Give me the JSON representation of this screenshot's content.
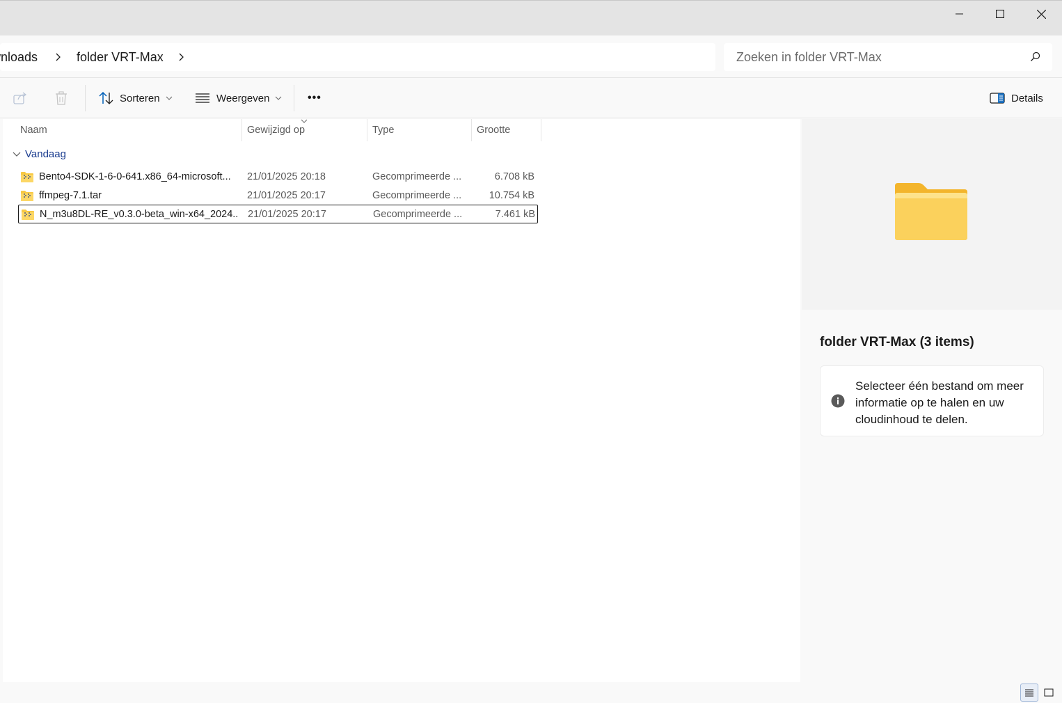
{
  "window": {
    "minimize": "minimize",
    "maximize": "maximize",
    "close": "close"
  },
  "address": {
    "crumbs": [
      "wnloads",
      "folder VRT-Max"
    ],
    "search_placeholder": "Zoeken in folder VRT-Max"
  },
  "toolbar": {
    "sort_label": "Sorteren",
    "view_label": "Weergeven",
    "more_label": "•••",
    "details_label": "Details"
  },
  "columns": {
    "name": "Naam",
    "modified": "Gewijzigd op",
    "type": "Type",
    "size": "Grootte"
  },
  "group": {
    "label": "Vandaag"
  },
  "files": [
    {
      "name": "Bento4-SDK-1-6-0-641.x86_64-microsoft...",
      "modified": "21/01/2025 20:18",
      "type": "Gecomprimeerde ...",
      "size": "6.708 kB"
    },
    {
      "name": "ffmpeg-7.1.tar",
      "modified": "21/01/2025 20:17",
      "type": "Gecomprimeerde ...",
      "size": "10.754 kB"
    },
    {
      "name": "N_m3u8DL-RE_v0.3.0-beta_win-x64_2024...",
      "modified": "21/01/2025 20:17",
      "type": "Gecomprimeerde ...",
      "size": "7.461 kB"
    }
  ],
  "details_pane": {
    "title": "folder VRT-Max (3 items)",
    "info": "Selecteer één bestand om meer informatie op te halen en uw cloudinhoud te delen."
  },
  "colors": {
    "folder": "#f8c943",
    "group_text": "#1a3c8f",
    "accent": "#005fb8"
  }
}
